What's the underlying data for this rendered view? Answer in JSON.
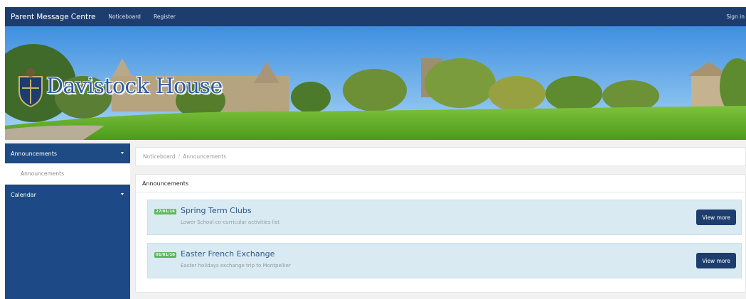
{
  "topnav": {
    "brand": "Parent Message Centre",
    "links": [
      "Noticeboard",
      "Register"
    ],
    "signin": "Sign in"
  },
  "banner": {
    "logo_text": "Davistock House"
  },
  "sidebar": {
    "items": [
      {
        "label": "Announcements",
        "expanded": true,
        "children": [
          "Announcements"
        ]
      },
      {
        "label": "Calendar",
        "expanded": false
      }
    ]
  },
  "breadcrumb": [
    "Noticeboard",
    "Announcements"
  ],
  "panel": {
    "title": "Announcements",
    "announcements": [
      {
        "date": "27/01/16",
        "title": "Spring Term Clubs",
        "description": "Lower School co-curricular activities list",
        "button": "View more"
      },
      {
        "date": "01/01/16",
        "title": "Easter French Exchange",
        "description": "Easter holidays exchange trip to Montpellier",
        "button": "View more"
      }
    ]
  },
  "colors": {
    "nav": "#1d3d6e",
    "sidebar": "#1d4a86",
    "badge": "#5cb85c",
    "card": "#d9eaf3"
  }
}
